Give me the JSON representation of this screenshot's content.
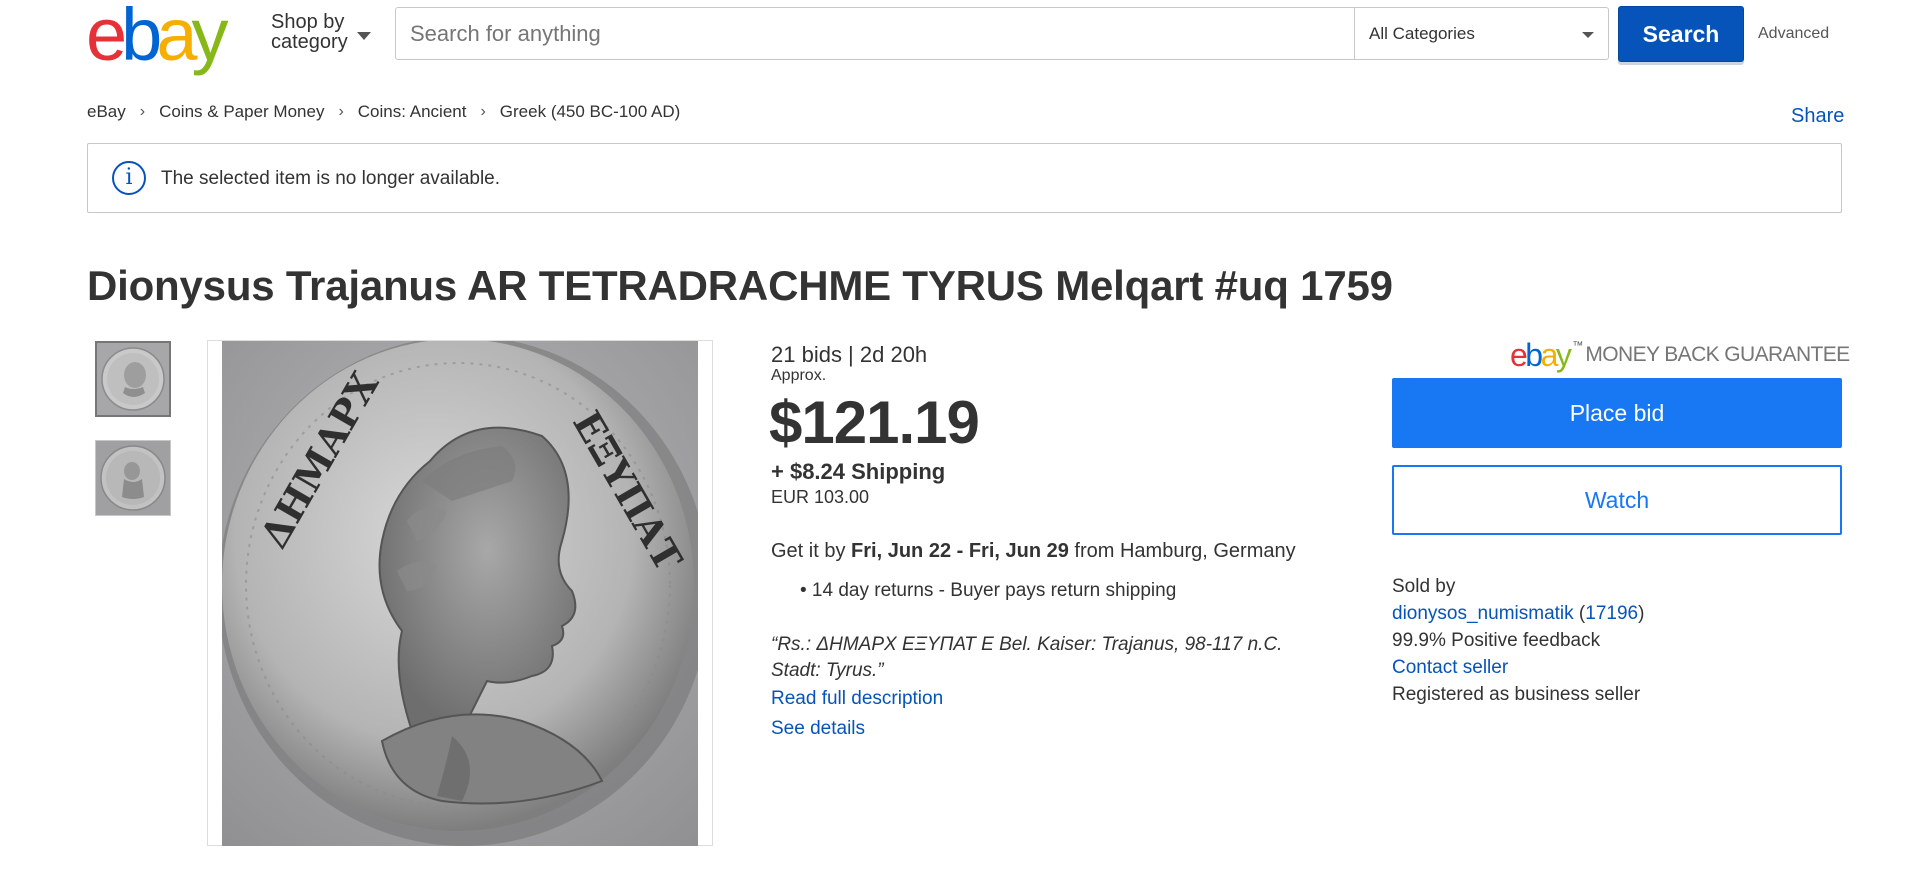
{
  "header": {
    "logo_letters": [
      "e",
      "b",
      "a",
      "y"
    ],
    "shop_by_line1": "Shop by",
    "shop_by_line2": "category",
    "search_placeholder": "Search for anything",
    "category_selected": "All Categories",
    "search_button": "Search",
    "advanced_link": "Advanced"
  },
  "breadcrumb": {
    "items": [
      "eBay",
      "Coins & Paper Money",
      "Coins: Ancient",
      "Greek (450 BC-100 AD)"
    ],
    "separator": "›"
  },
  "share_link": "Share",
  "alert": {
    "icon_glyph": "i",
    "text": "The selected item is no longer available."
  },
  "listing": {
    "title": "Dionysus Trajanus AR TETRADRACHME TYRUS Melqart #uq 1759",
    "bids_time": "21 bids | 2d 20h",
    "approx_label": "Approx.",
    "price": "$121.19",
    "shipping": "+ $8.24 Shipping",
    "original_currency": "EUR 103.00",
    "delivery_prefix": "Get it by ",
    "delivery_dates": "Fri, Jun 22 - Fri, Jun 29",
    "delivery_suffix": " from Hamburg, Germany",
    "returns": "• 14 day returns - Buyer pays return shipping",
    "quote": "“Rs.: ΔΗΜΑΡΧ ΕΞΥΠΑΤ Ε Bel. Kaiser: Trajanus, 98-117 n.C. Stadt: Tyrus.”",
    "read_full": "Read full description",
    "see_details": "See details"
  },
  "right_panel": {
    "mbg_logo_letters": [
      "e",
      "b",
      "a",
      "y"
    ],
    "mbg_tm": "™",
    "mbg_text": "MONEY BACK GUARANTEE",
    "place_bid": "Place bid",
    "watch": "Watch",
    "sold_by": "Sold by",
    "seller_name": "dionysos_numismatik",
    "seller_score": "17196",
    "paren_open": "(",
    "paren_close": ")",
    "feedback": "99.9% Positive feedback",
    "contact": "Contact seller",
    "registered": "Registered as business seller"
  },
  "colors": {
    "ebay_red": "#e53238",
    "ebay_blue": "#0064d2",
    "ebay_yellow": "#f5af02",
    "ebay_green": "#86b817",
    "link_blue": "#0654ba",
    "cta_blue": "#1877f2"
  },
  "icons": [
    "info-icon",
    "chevron-down-icon",
    "coin-image"
  ]
}
